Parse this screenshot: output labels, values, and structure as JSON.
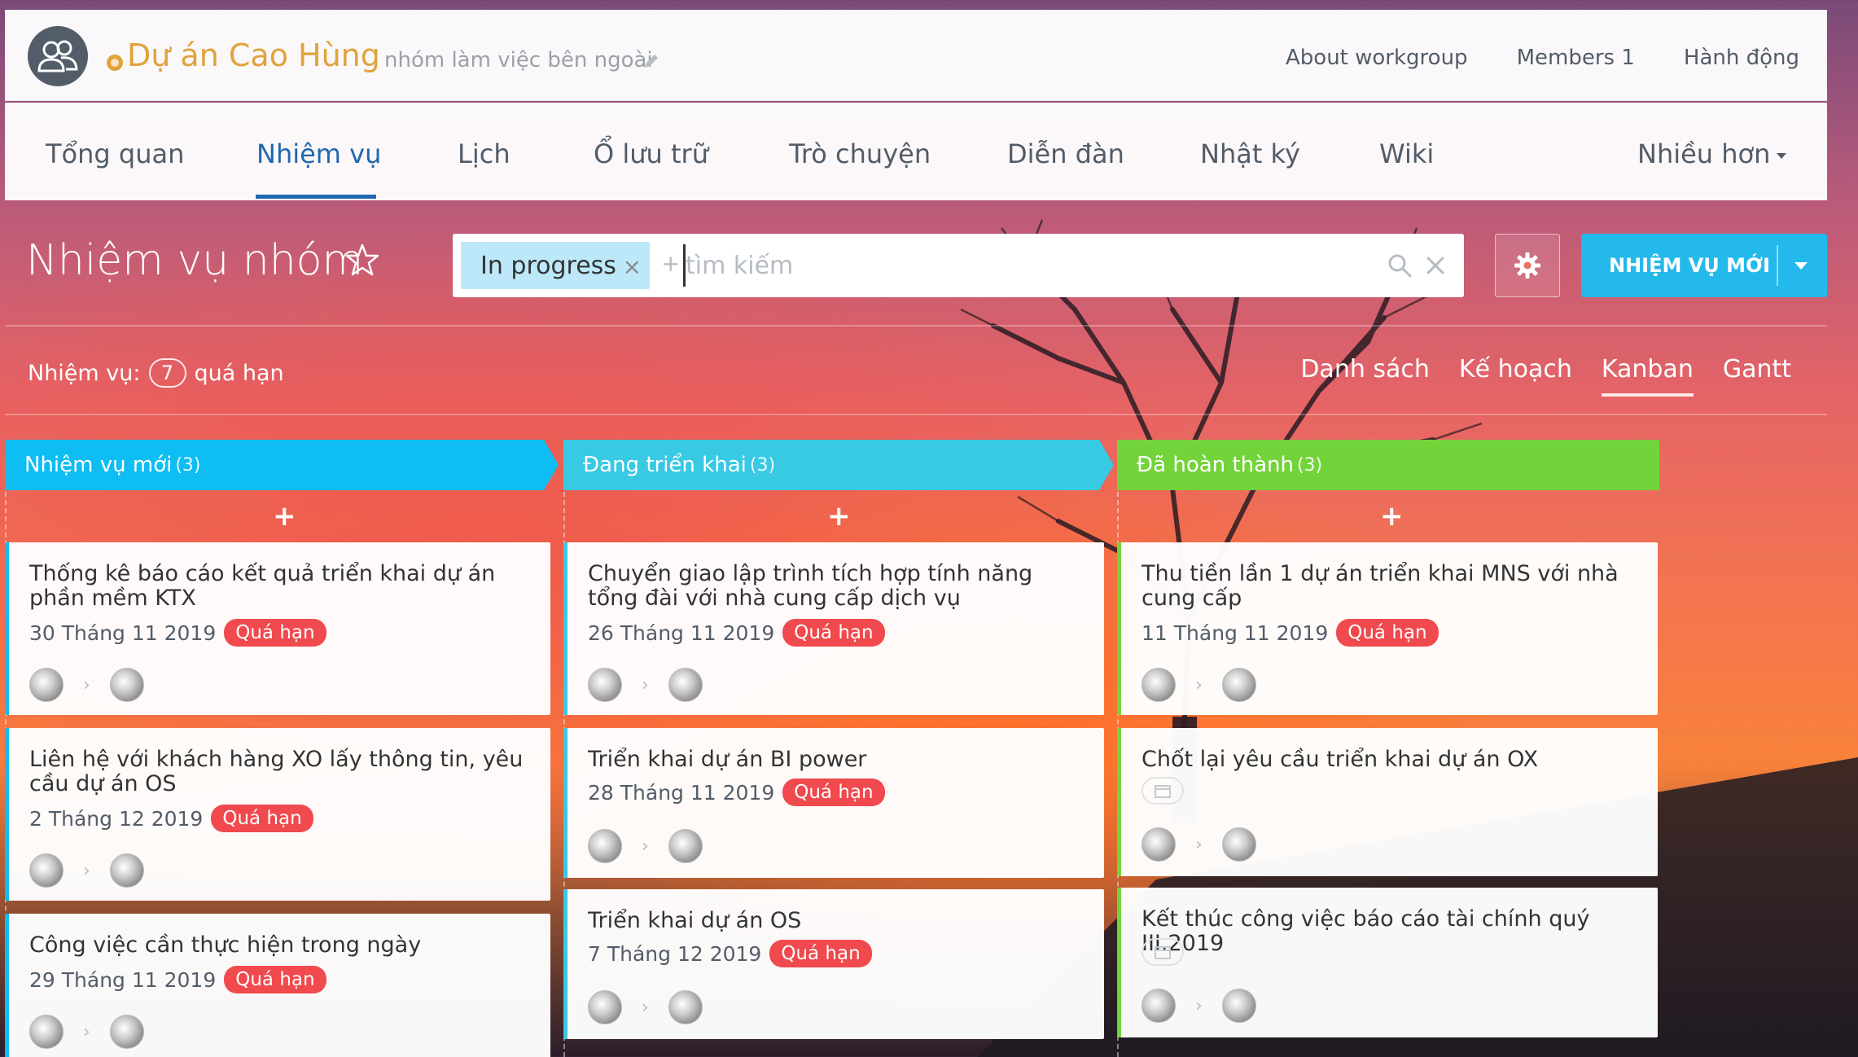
{
  "header": {
    "group_title": "Dự án Cao Hùng",
    "group_subtitle": "nhóm làm việc bên ngoài",
    "links": [
      "About workgroup",
      "Members 1",
      "Hành động"
    ]
  },
  "tabs": [
    {
      "label": "Tổng quan",
      "active": false
    },
    {
      "label": "Nhiệm vụ",
      "active": true
    },
    {
      "label": "Lịch",
      "active": false
    },
    {
      "label": "Ổ lưu trữ",
      "active": false
    },
    {
      "label": "Trò chuyện",
      "active": false
    },
    {
      "label": "Diễn đàn",
      "active": false
    },
    {
      "label": "Nhật ký",
      "active": false
    },
    {
      "label": "Wiki",
      "active": false
    },
    {
      "label": "Nhiều hơn",
      "active": false
    }
  ],
  "page": {
    "title": "Nhiệm vụ nhóm",
    "filter_chip": "In progress",
    "search_placeholder": "tìm kiếm",
    "new_task_button": "NHIỆM VỤ MỚI"
  },
  "counter": {
    "prefix": "Nhiệm vụ:",
    "count": "7",
    "suffix": "quá hạn"
  },
  "views": [
    "Danh sách",
    "Kế hoạch",
    "Kanban",
    "Gantt"
  ],
  "active_view": "Kanban",
  "colors": {
    "col_new": "#0ebdf2",
    "col_progress": "#38c9e3",
    "col_done": "#73d33a",
    "overdue": "#f0494e",
    "accent": "#2067b0",
    "button": "#23b9eb"
  },
  "columns": [
    {
      "name": "Nhiệm vụ mới",
      "count": "(3)",
      "cards": [
        {
          "title": "Thống kê báo cáo kết quả triển khai dự án phần mềm KTX",
          "date": "30 Tháng 11 2019",
          "badge": "Quá hạn"
        },
        {
          "title": "Liên hệ với khách hàng XO lấy thông tin, yêu cầu dự án OS",
          "date": "2 Tháng 12 2019",
          "badge": "Quá hạn"
        },
        {
          "title": "Công việc cần thực hiện trong ngày",
          "date": "29 Tháng 11 2019",
          "badge": "Quá hạn"
        }
      ]
    },
    {
      "name": "Đang triển khai",
      "count": "(3)",
      "cards": [
        {
          "title": "Chuyển giao lập trình tích hợp tính năng tổng đài với nhà cung cấp dịch vụ",
          "date": "26 Tháng 11 2019",
          "badge": "Quá hạn"
        },
        {
          "title": "Triển khai dự án BI power",
          "date": "28 Tháng 11 2019",
          "badge": "Quá hạn"
        },
        {
          "title": "Triển khai dự án OS",
          "date": "7 Tháng 12 2019",
          "badge": "Quá hạn"
        }
      ]
    },
    {
      "name": "Đã hoàn thành",
      "count": "(3)",
      "cards": [
        {
          "title": "Thu tiền lần 1 dự án triển khai MNS với nhà cung cấp",
          "date": "11 Tháng 11 2019",
          "badge": "Quá hạn"
        },
        {
          "title": "Chốt lại yêu cầu triển khai dự án OX",
          "date": "",
          "badge": ""
        },
        {
          "title": "Kết thúc công việc báo cáo tài chính quý III.2019",
          "date": "",
          "badge": ""
        }
      ]
    }
  ]
}
